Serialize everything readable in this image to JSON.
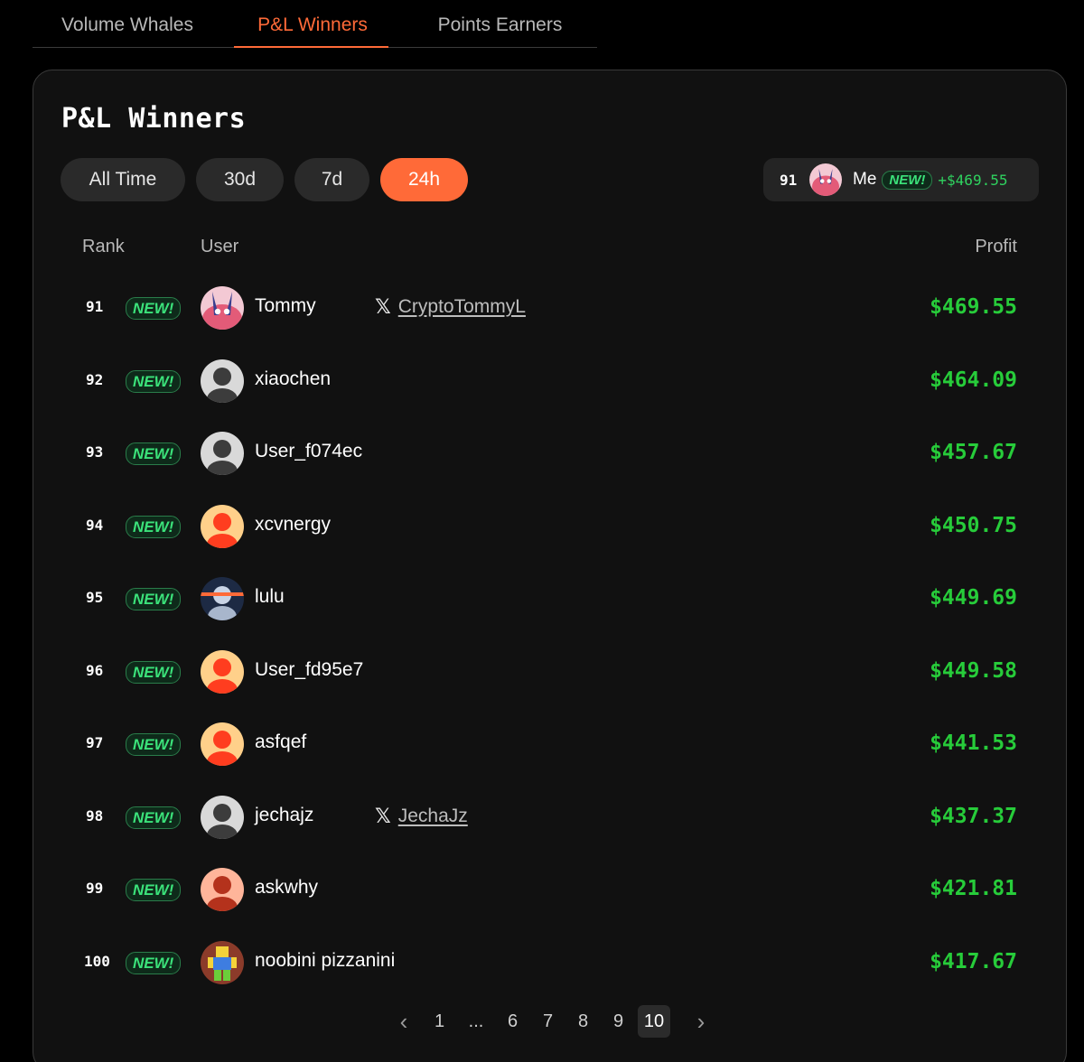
{
  "tabs": [
    {
      "label": "Volume Whales"
    },
    {
      "label": "P&L Winners"
    },
    {
      "label": "Points Earners"
    }
  ],
  "active_tab": "P&L Winners",
  "panel": {
    "title": "P&L Winners",
    "filters": [
      {
        "label": "All Time"
      },
      {
        "label": "30d"
      },
      {
        "label": "7d"
      },
      {
        "label": "24h"
      }
    ],
    "active_filter": "24h"
  },
  "me": {
    "rank": "91",
    "label": "Me",
    "badge": "NEW!",
    "profit": "+$469.55"
  },
  "table": {
    "headers": {
      "rank": "Rank",
      "user": "User",
      "profit": "Profit"
    },
    "rows": [
      {
        "rank": "91",
        "badge": "NEW!",
        "name": "Tommy",
        "x_handle": "CryptoTommyL",
        "profit": "$469.55",
        "avatar": "pink-anime"
      },
      {
        "rank": "92",
        "badge": "NEW!",
        "name": "xiaochen",
        "x_handle": "",
        "profit": "$464.09",
        "avatar": "gray-silhouette"
      },
      {
        "rank": "93",
        "badge": "NEW!",
        "name": "User_f074ec",
        "x_handle": "",
        "profit": "$457.67",
        "avatar": "gray-silhouette"
      },
      {
        "rank": "94",
        "badge": "NEW!",
        "name": "xcvnergy",
        "x_handle": "",
        "profit": "$450.75",
        "avatar": "red-silhouette"
      },
      {
        "rank": "95",
        "badge": "NEW!",
        "name": "lulu",
        "x_handle": "",
        "profit": "$449.69",
        "avatar": "blue-statue"
      },
      {
        "rank": "96",
        "badge": "NEW!",
        "name": "User_fd95e7",
        "x_handle": "",
        "profit": "$449.58",
        "avatar": "red-silhouette"
      },
      {
        "rank": "97",
        "badge": "NEW!",
        "name": "asfqef",
        "x_handle": "",
        "profit": "$441.53",
        "avatar": "red-silhouette"
      },
      {
        "rank": "98",
        "badge": "NEW!",
        "name": "jechajz",
        "x_handle": "JechaJz",
        "profit": "$437.37",
        "avatar": "gray-silhouette"
      },
      {
        "rank": "99",
        "badge": "NEW!",
        "name": "askwhy",
        "x_handle": "",
        "profit": "$421.81",
        "avatar": "dark-red-silhouette"
      },
      {
        "rank": "100",
        "badge": "NEW!",
        "name": "noobini pizzanini",
        "x_handle": "",
        "profit": "$417.67",
        "avatar": "pixel-character"
      }
    ]
  },
  "pagination": {
    "pages": [
      "1",
      "...",
      "6",
      "7",
      "8",
      "9",
      "10"
    ],
    "current": "10",
    "prev_icon": "chevron-left-icon",
    "next_icon": "chevron-right-icon"
  },
  "colors": {
    "accent": "#ff6a38",
    "profit": "#27cc3a",
    "badge": "#3be27a",
    "panel_bg": "#111111"
  }
}
